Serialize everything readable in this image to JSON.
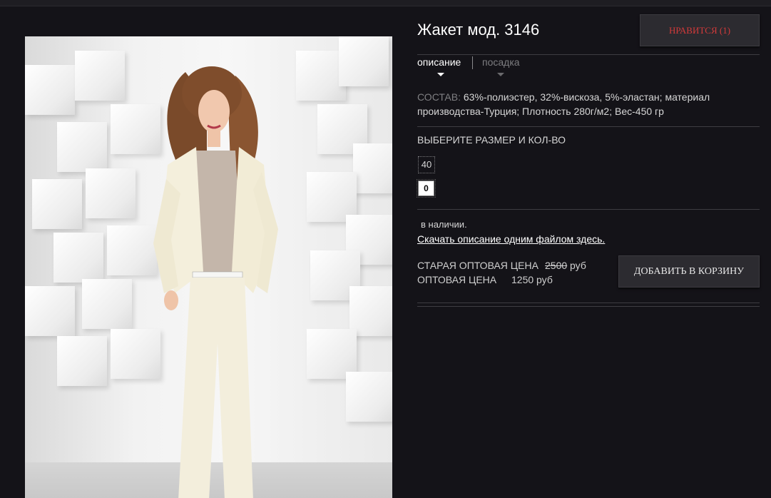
{
  "product": {
    "title": "Жакет мод. 3146",
    "photo_alt": "Жакет мод. 3146"
  },
  "like_button": {
    "label": "НРАВИТСЯ (1)"
  },
  "tabs": [
    {
      "label": "описание",
      "active": true
    },
    {
      "label": "посадка",
      "active": false
    }
  ],
  "composition": {
    "label": "СОСТАВ:",
    "text": "63%-полиэстер, 32%-вискоза, 5%-эластан; материал производства-Турция; Плотность 280г/м2; Вес-450 гр"
  },
  "size_selection": {
    "heading": "ВЫБЕРИТЕ РАЗМЕР И КОЛ-ВО",
    "sizes": [
      {
        "size": "40",
        "quantity": "0"
      }
    ]
  },
  "availability": {
    "text": "в наличии."
  },
  "download": {
    "link_text": "Скачать описание одним файлом здесь."
  },
  "prices": {
    "old_label": "СТАРАЯ ОПТОВАЯ ЦЕНА",
    "old_value": "2500",
    "old_currency": "руб",
    "current_label": "ОПТОВАЯ ЦЕНА",
    "current_value": "1250 руб"
  },
  "cart_button": {
    "label": "ДОБАВИТЬ В КОРЗИНУ"
  },
  "colors": {
    "background": "#141318",
    "like_text": "#d33a3a",
    "button_bg": "#2c2b30"
  }
}
